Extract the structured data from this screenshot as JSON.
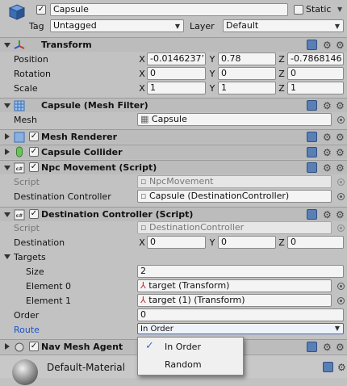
{
  "object": {
    "name": "Capsule",
    "static_label": "Static",
    "tag_label": "Tag",
    "tag_value": "Untagged",
    "layer_label": "Layer",
    "layer_value": "Default"
  },
  "transform": {
    "title": "Transform",
    "position_label": "Position",
    "rotation_label": "Rotation",
    "scale_label": "Scale",
    "axes": [
      "X",
      "Y",
      "Z"
    ],
    "position": [
      "-0.0146237’",
      "0.78",
      "-0.7868146"
    ],
    "rotation": [
      "0",
      "0",
      "0"
    ],
    "scale": [
      "1",
      "1",
      "1"
    ]
  },
  "mesh_filter": {
    "title": "Capsule (Mesh Filter)",
    "mesh_label": "Mesh",
    "mesh_value": "Capsule"
  },
  "mesh_renderer": {
    "title": "Mesh Renderer"
  },
  "capsule_collider": {
    "title": "Capsule Collider"
  },
  "npc_movement": {
    "title": "Npc Movement (Script)",
    "script_label": "Script",
    "script_value": "NpcMovement",
    "dest_label": "Destination Controller",
    "dest_value": "Capsule (DestinationController)"
  },
  "dest_controller": {
    "title": "Destination Controller (Script)",
    "script_label": "Script",
    "script_value": "DestinationController",
    "destination_label": "Destination",
    "destination": [
      "0",
      "0",
      "0"
    ],
    "targets_label": "Targets",
    "size_label": "Size",
    "size_value": "2",
    "element0_label": "Element 0",
    "element0_value": "target (Transform)",
    "element1_label": "Element 1",
    "element1_value": "target (1) (Transform)",
    "order_label": "Order",
    "order_value": "0",
    "route_label": "Route",
    "route_value": "In Order"
  },
  "nav_mesh_agent": {
    "title": "Nav Mesh Agent"
  },
  "material": {
    "name": "Default-Material"
  },
  "route_menu": {
    "options": [
      "In Order",
      "Random"
    ],
    "selected": "In Order"
  },
  "colors": {
    "accent_blue": "#3b6fc4",
    "route_label": "#1a53c9"
  }
}
